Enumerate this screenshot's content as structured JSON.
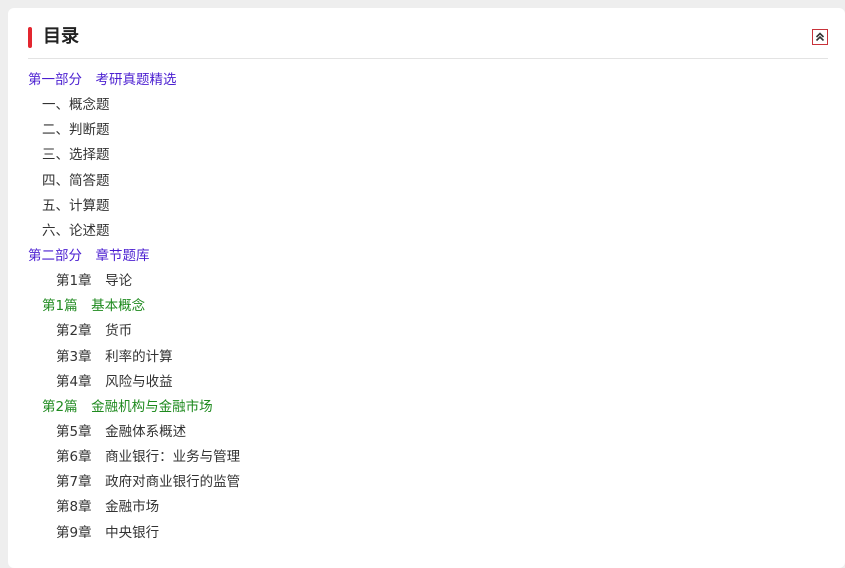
{
  "header": {
    "title": "目录",
    "collapse_icon": "double-chevron-up-icon",
    "accent_color": "#e3262f"
  },
  "colors": {
    "part": "#4b1fd1",
    "pian": "#1e8a1e",
    "text": "#333333"
  },
  "toc": [
    {
      "level": "part",
      "label": "第一部分　考研真题精选"
    },
    {
      "level": "sec",
      "label": "一、概念题"
    },
    {
      "level": "sec",
      "label": "二、判断题"
    },
    {
      "level": "sec",
      "label": "三、选择题"
    },
    {
      "level": "sec",
      "label": "四、简答题"
    },
    {
      "level": "sec",
      "label": "五、计算题"
    },
    {
      "level": "sec",
      "label": "六、论述题"
    },
    {
      "level": "part",
      "label": "第二部分　章节题库"
    },
    {
      "level": "chap",
      "label": "第1章　导论"
    },
    {
      "level": "pian",
      "label": "第1篇　基本概念"
    },
    {
      "level": "chap",
      "label": "第2章　货币"
    },
    {
      "level": "chap",
      "label": "第3章　利率的计算"
    },
    {
      "level": "chap",
      "label": "第4章　风险与收益"
    },
    {
      "level": "pian",
      "label": "第2篇　金融机构与金融市场"
    },
    {
      "level": "chap",
      "label": "第5章　金融体系概述"
    },
    {
      "level": "chap",
      "label": "第6章　商业银行：业务与管理"
    },
    {
      "level": "chap",
      "label": "第7章　政府对商业银行的监管"
    },
    {
      "level": "chap",
      "label": "第8章　金融市场"
    },
    {
      "level": "chap",
      "label": "第9章　中央银行"
    }
  ]
}
